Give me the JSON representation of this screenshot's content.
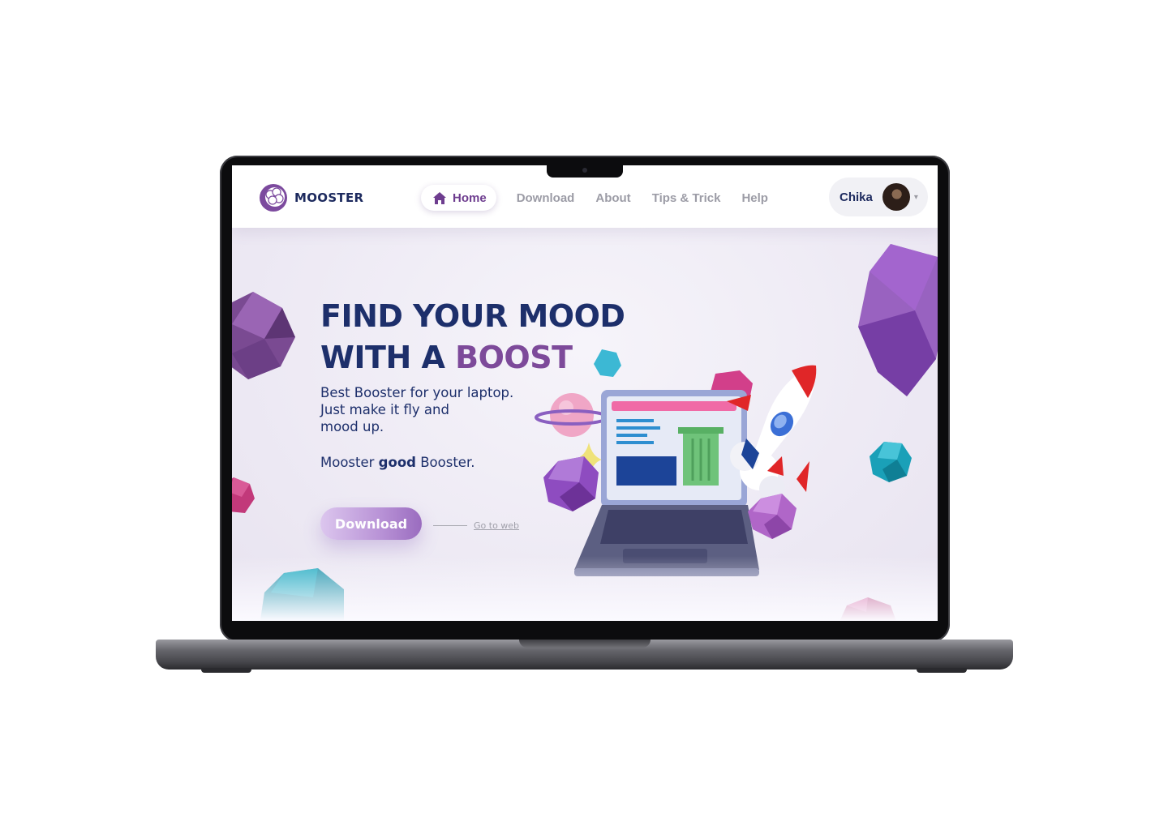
{
  "brand": {
    "name": "MOOSTER",
    "logo_icon": "cloud-logo-icon"
  },
  "nav": {
    "home": "Home",
    "home_icon": "home-icon",
    "items": [
      "Download",
      "About",
      "Tips & Trick",
      "Help"
    ]
  },
  "user": {
    "name": "Chika",
    "caret": "▾"
  },
  "hero": {
    "headline_line1": "FIND YOUR MOOD",
    "headline_line2_prefix": "WITH A ",
    "headline_line2_accent": "BOOST",
    "subtitle_line1": "Best Booster for your laptop.",
    "subtitle_line2": "Just make it fly and",
    "subtitle_line3": "mood up.",
    "tagline_before": "Mooster ",
    "tagline_bold": "good",
    "tagline_after": " Booster.",
    "download_label": "Download",
    "go_to_web": "Go to web"
  },
  "colors": {
    "navy": "#1d2f6b",
    "purple": "#7d4a9a",
    "nav_inactive": "#9c9ca6",
    "teal": "#1aa0b8",
    "magenta": "#c2397a"
  }
}
